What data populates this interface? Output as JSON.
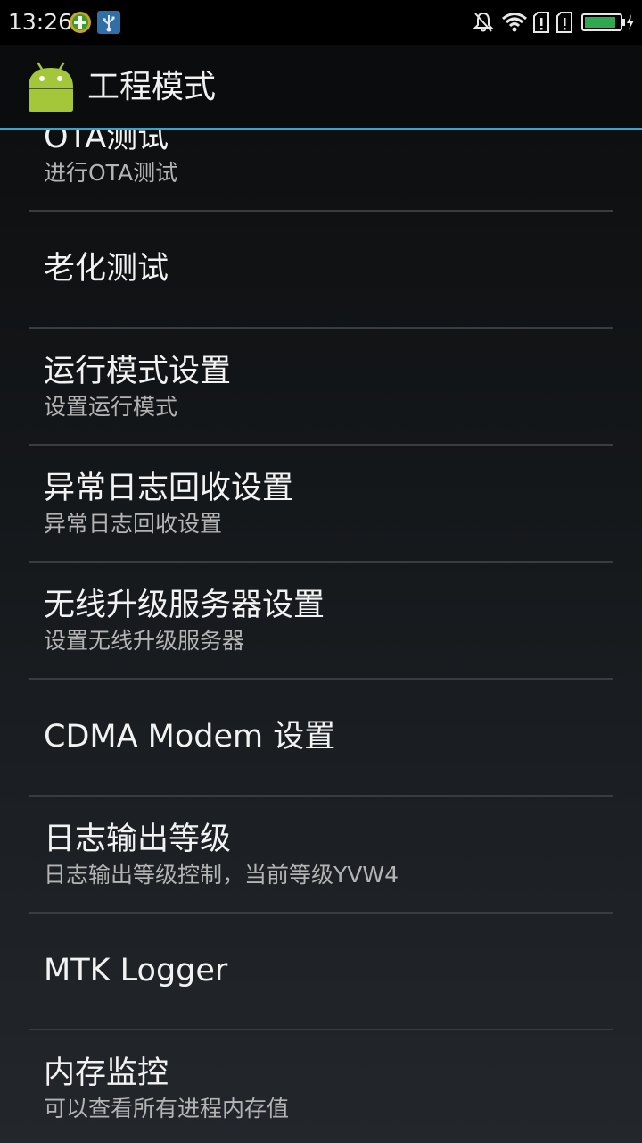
{
  "status_bar": {
    "time": "13:26",
    "notification_icons": [
      "plus-notification-icon",
      "usb-debug-icon"
    ],
    "system_icons": [
      "bell-off-icon",
      "wifi-icon",
      "sim-no-signal-icon",
      "sim-no-signal-icon",
      "battery-charging-icon"
    ],
    "battery_level": 0.9
  },
  "action_bar": {
    "title": "工程模式",
    "app_icon": "android-icon"
  },
  "colors": {
    "accent_divider": "#35a6cc",
    "battery_fill": "#2fa84f",
    "android_green": "#a4c639"
  },
  "list": {
    "items": [
      {
        "title": "OTA测试",
        "summary": "进行OTA测试"
      },
      {
        "title": "老化测试",
        "summary": ""
      },
      {
        "title": "运行模式设置",
        "summary": "设置运行模式"
      },
      {
        "title": "异常日志回收设置",
        "summary": "异常日志回收设置"
      },
      {
        "title": "无线升级服务器设置",
        "summary": "设置无线升级服务器"
      },
      {
        "title": "CDMA Modem 设置",
        "summary": ""
      },
      {
        "title": "日志输出等级",
        "summary": "日志输出等级控制，当前等级YVW4"
      },
      {
        "title": "MTK Logger",
        "summary": ""
      },
      {
        "title": "内存监控",
        "summary": "可以查看所有进程内存值"
      }
    ]
  }
}
